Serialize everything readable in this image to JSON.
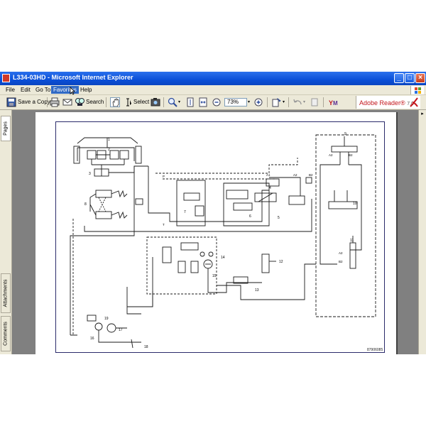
{
  "window": {
    "title": "L334-03HD - Microsoft Internet Explorer",
    "buttons": {
      "minimize": "_",
      "maximize": "□",
      "close": "×"
    }
  },
  "menubar": {
    "items": [
      "File",
      "Edit",
      "Go To",
      "Favorites",
      "Help"
    ],
    "active_item": "Favorites"
  },
  "toolbar": {
    "save_copy_label": "Save a Copy",
    "search_label": "Search",
    "select_label": "Select",
    "zoom_value": "73%"
  },
  "brand": {
    "name": "Adobe Reader",
    "reg": "®",
    "version": "7.0"
  },
  "side_tabs": {
    "pages": "Pages",
    "attachments": "Attachments",
    "comments": "Comments"
  },
  "diagram": {
    "part_number": "87906085",
    "port_labels": [
      "A1",
      "A2",
      "B2",
      "A2",
      "B2",
      "A2",
      "B2",
      "P",
      "T",
      "T"
    ],
    "callouts": [
      "1",
      "2",
      "3",
      "4",
      "5",
      "6",
      "7",
      "8",
      "9",
      "10",
      "11",
      "12",
      "13",
      "14",
      "15",
      "16",
      "17",
      "18",
      "19"
    ]
  },
  "colors": {
    "title_bar": "#0a4fd8",
    "page_frame": "#2b2b6b",
    "brand_red": "#c4161c"
  }
}
